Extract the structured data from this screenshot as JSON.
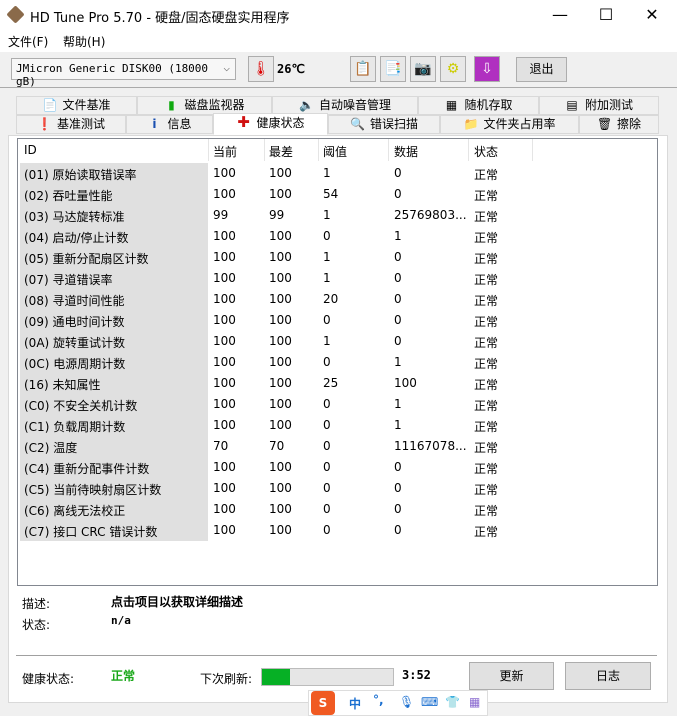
{
  "window": {
    "title": "HD Tune Pro 5.70 - 硬盘/固态硬盘实用程序",
    "minimize": "—",
    "maximize": "☐",
    "close": "✕"
  },
  "menu": [
    "文件(F)",
    "帮助(H)"
  ],
  "toolbar": {
    "drive": "JMicron Generic DISK00 (18000 gB)",
    "temperature": "26℃",
    "exit": "退出"
  },
  "tabs_top": [
    "文件基准",
    "磁盘监视器",
    "自动噪音管理",
    "随机存取",
    "附加测试"
  ],
  "tabs_bottom": [
    "基准测试",
    "信息",
    "健康状态",
    "错误扫描",
    "文件夹占用率",
    "擦除"
  ],
  "active_tab": "健康状态",
  "table": {
    "headers": [
      "ID",
      "当前",
      "最差",
      "阈值",
      "数据",
      "状态"
    ],
    "rows": [
      [
        "(01) 原始读取错误率",
        "100",
        "100",
        "1",
        "0",
        "正常"
      ],
      [
        "(02) 吞吐量性能",
        "100",
        "100",
        "54",
        "0",
        "正常"
      ],
      [
        "(03) 马达旋转标准",
        "99",
        "99",
        "1",
        "25769803...",
        "正常"
      ],
      [
        "(04) 启动/停止计数",
        "100",
        "100",
        "0",
        "1",
        "正常"
      ],
      [
        "(05) 重新分配扇区计数",
        "100",
        "100",
        "1",
        "0",
        "正常"
      ],
      [
        "(07) 寻道错误率",
        "100",
        "100",
        "1",
        "0",
        "正常"
      ],
      [
        "(08) 寻道时间性能",
        "100",
        "100",
        "20",
        "0",
        "正常"
      ],
      [
        "(09) 通电时间计数",
        "100",
        "100",
        "0",
        "0",
        "正常"
      ],
      [
        "(0A) 旋转重试计数",
        "100",
        "100",
        "1",
        "0",
        "正常"
      ],
      [
        "(0C) 电源周期计数",
        "100",
        "100",
        "0",
        "1",
        "正常"
      ],
      [
        "(16) 未知属性",
        "100",
        "100",
        "25",
        "100",
        "正常"
      ],
      [
        "(C0) 不安全关机计数",
        "100",
        "100",
        "0",
        "1",
        "正常"
      ],
      [
        "(C1) 负载周期计数",
        "100",
        "100",
        "0",
        "1",
        "正常"
      ],
      [
        "(C2) 温度",
        "70",
        "70",
        "0",
        "11167078...",
        "正常"
      ],
      [
        "(C4) 重新分配事件计数",
        "100",
        "100",
        "0",
        "0",
        "正常"
      ],
      [
        "(C5) 当前待映射扇区计数",
        "100",
        "100",
        "0",
        "0",
        "正常"
      ],
      [
        "(C6) 离线无法校正",
        "100",
        "100",
        "0",
        "0",
        "正常"
      ],
      [
        "(C7) 接口 CRC 错误计数",
        "100",
        "100",
        "0",
        "0",
        "正常"
      ]
    ]
  },
  "details": {
    "desc_label": "描述:",
    "desc_value": "点击项目以获取详细描述",
    "status_label": "状态:",
    "status_value": "n/a"
  },
  "footer": {
    "health_label": "健康状态:",
    "health_value": "正常",
    "next_label": "下次刷新:",
    "progress": 0.21,
    "time": "3:52",
    "refresh": "更新",
    "log": "日志"
  },
  "ime": {
    "lang": "中",
    "punct": "°,"
  },
  "colors": {
    "ok": "#1aa81a",
    "progress": "#06b025"
  }
}
